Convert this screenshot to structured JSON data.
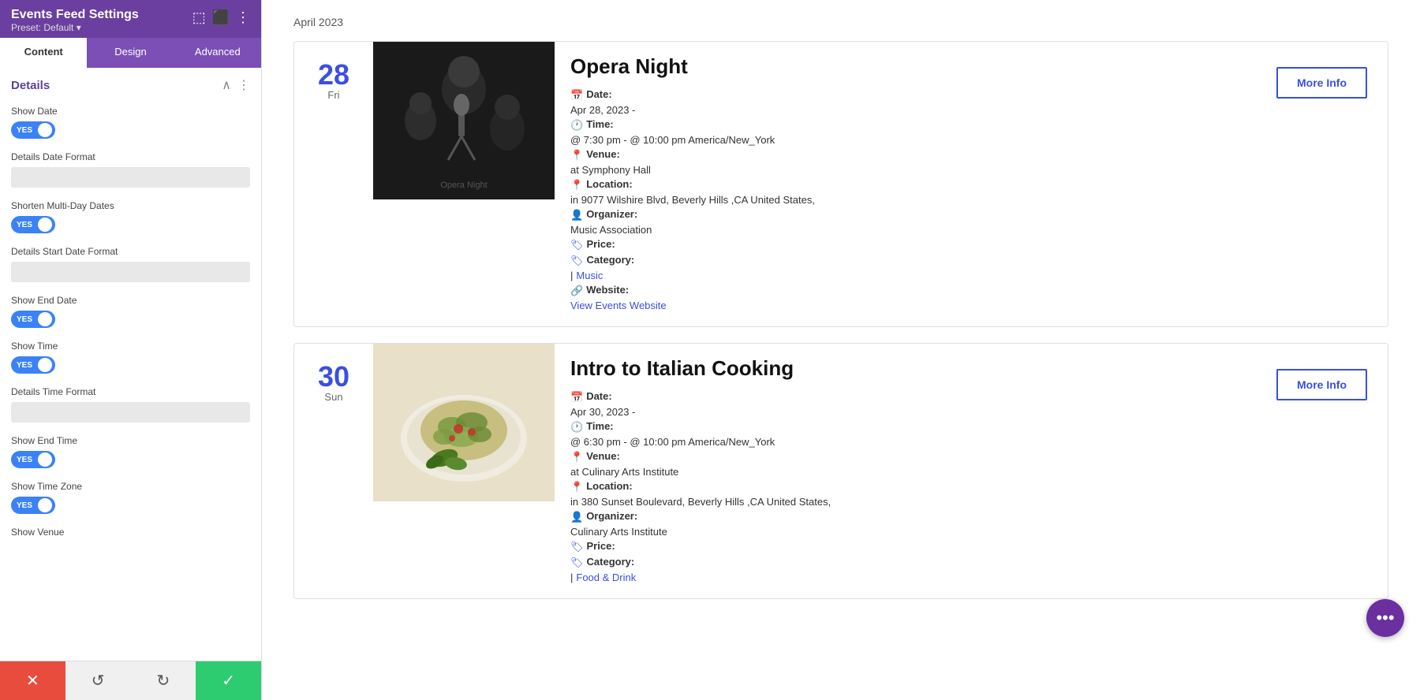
{
  "panel": {
    "title": "Events Feed Settings",
    "preset": "Preset: Default ▾",
    "header_icons": [
      "⬚",
      "⬛",
      "⋮"
    ],
    "tabs": [
      {
        "id": "content",
        "label": "Content",
        "active": true
      },
      {
        "id": "design",
        "label": "Design",
        "active": false
      },
      {
        "id": "advanced",
        "label": "Advanced",
        "active": false
      }
    ],
    "sections": {
      "details": {
        "title": "Details",
        "settings": [
          {
            "id": "show-date",
            "label": "Show Date",
            "type": "toggle",
            "value": true
          },
          {
            "id": "details-date-format",
            "label": "Details Date Format",
            "type": "text",
            "value": ""
          },
          {
            "id": "shorten-multi-day",
            "label": "Shorten Multi-Day Dates",
            "type": "toggle",
            "value": true
          },
          {
            "id": "details-start-date-format",
            "label": "Details Start Date Format",
            "type": "text",
            "value": ""
          },
          {
            "id": "show-end-date",
            "label": "Show End Date",
            "type": "toggle",
            "value": true
          },
          {
            "id": "show-time",
            "label": "Show Time",
            "type": "toggle",
            "value": true
          },
          {
            "id": "details-time-format",
            "label": "Details Time Format",
            "type": "text",
            "value": ""
          },
          {
            "id": "show-end-time",
            "label": "Show End Time",
            "type": "toggle",
            "value": true
          },
          {
            "id": "show-time-zone",
            "label": "Show Time Zone",
            "type": "toggle",
            "value": true
          },
          {
            "id": "show-venue",
            "label": "Show Venue",
            "type": "label_only",
            "value": ""
          }
        ]
      }
    },
    "toolbar": {
      "close": "✕",
      "reset": "↺",
      "redo": "↻",
      "confirm": "✓"
    }
  },
  "main": {
    "month_label": "April 2023",
    "events": [
      {
        "id": "opera-night",
        "day_num": "28",
        "day_name": "Fri",
        "title": "Opera Night",
        "more_info_label": "More Info",
        "date_label": "Date:",
        "date_value": "Apr 28, 2023 -",
        "time_label": "Time:",
        "time_value": "@ 7:30 pm - @ 10:00 pm America/New_York",
        "venue_label": "Venue:",
        "venue_value": "at Symphony Hall",
        "location_label": "Location:",
        "location_value": "in 9077 Wilshire Blvd, Beverly Hills ,CA United States,",
        "organizer_label": "Organizer:",
        "organizer_value": "Music Association",
        "price_label": "Price:",
        "price_value": "",
        "category_label": "Category:",
        "category_value": "| Music",
        "category_link": "Music",
        "website_label": "Website:",
        "website_value": "View Events Website",
        "image_type": "opera"
      },
      {
        "id": "italian-cooking",
        "day_num": "30",
        "day_name": "Sun",
        "title": "Intro to Italian Cooking",
        "more_info_label": "More Info",
        "date_label": "Date:",
        "date_value": "Apr 30, 2023 -",
        "time_label": "Time:",
        "time_value": "@ 6:30 pm - @ 10:00 pm America/New_York",
        "venue_label": "Venue:",
        "venue_value": "at Culinary Arts Institute",
        "location_label": "Location:",
        "location_value": "in 380 Sunset Boulevard, Beverly Hills ,CA United States,",
        "organizer_label": "Organizer:",
        "organizer_value": "Culinary Arts Institute",
        "price_label": "Price:",
        "price_value": "",
        "category_label": "Category:",
        "category_value": "| Food & Drink",
        "category_link": "Food & Drink",
        "image_type": "cooking"
      }
    ]
  },
  "bubble": {
    "icon": "•••"
  }
}
